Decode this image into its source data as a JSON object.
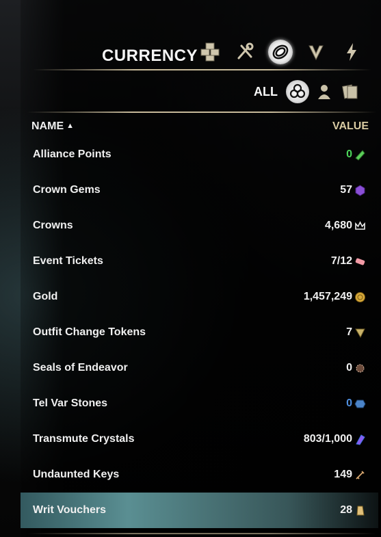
{
  "header": {
    "title": "CURRENCY",
    "categories": [
      {
        "name": "blocks-icon",
        "active": false
      },
      {
        "name": "tools-icon",
        "active": false
      },
      {
        "name": "coin-icon",
        "active": true
      },
      {
        "name": "chevron-icon",
        "active": false
      },
      {
        "name": "lightning-icon",
        "active": false
      }
    ]
  },
  "filters": {
    "label": "ALL",
    "items": [
      {
        "name": "all-filter-icon",
        "active": true
      },
      {
        "name": "character-icon",
        "active": false
      },
      {
        "name": "account-icon",
        "active": false
      }
    ]
  },
  "columns": {
    "name": "NAME",
    "sort_arrow": "▲",
    "value": "VALUE"
  },
  "rows": [
    {
      "name": "Alliance Points",
      "value": "0",
      "value_color": "green",
      "icon": "alliance-points-icon"
    },
    {
      "name": "Crown Gems",
      "value": "57",
      "icon": "crown-gem-icon"
    },
    {
      "name": "Crowns",
      "value": "4,680",
      "icon": "crown-icon"
    },
    {
      "name": "Event Tickets",
      "value": "7/12",
      "icon": "ticket-icon"
    },
    {
      "name": "Gold",
      "value": "1,457,249",
      "icon": "gold-icon"
    },
    {
      "name": "Outfit Change Tokens",
      "value": "7",
      "icon": "outfit-token-icon"
    },
    {
      "name": "Seals of Endeavor",
      "value": "0",
      "icon": "seal-icon"
    },
    {
      "name": "Tel Var Stones",
      "value": "0",
      "value_color": "blue",
      "icon": "telvar-icon"
    },
    {
      "name": "Transmute Crystals",
      "value": "803/1,000",
      "icon": "crystal-icon"
    },
    {
      "name": "Undaunted Keys",
      "value": "149",
      "icon": "key-icon"
    },
    {
      "name": "Writ Vouchers",
      "value": "28",
      "icon": "voucher-icon",
      "selected": true
    }
  ],
  "colors": {
    "accent_gold": "#d9cba2",
    "green_value": "#4cd65a",
    "blue_value": "#4f8fe0",
    "selected_row": "#6fb3b8"
  }
}
